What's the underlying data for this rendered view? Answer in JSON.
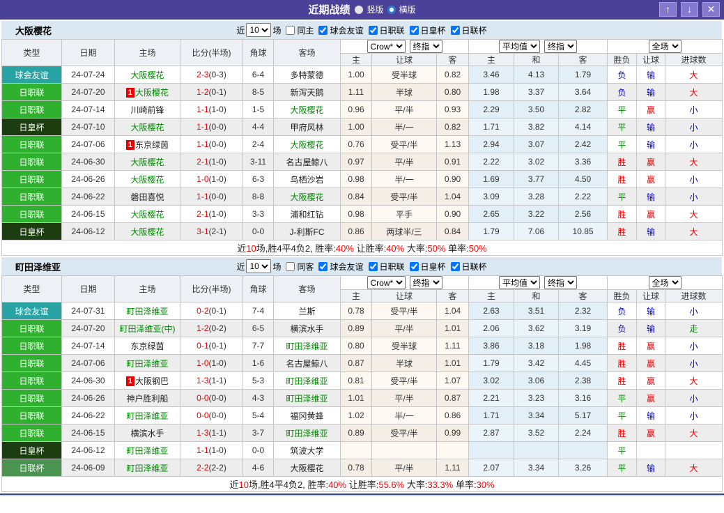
{
  "titlebar": {
    "title": "近期战绩",
    "vertical_label": "竖版",
    "horizontal_label": "横版",
    "buttons": {
      "up_icon": "↑",
      "down_icon": "↓",
      "close_icon": "✕"
    }
  },
  "colors": {
    "topbar": "#4C4199",
    "section_band": "#DBE7F1",
    "type_friendly": "#29A3A3",
    "type_jleague": "#2FB12F",
    "type_emperor": "#1B3D10",
    "type_lcup": "#4A9350",
    "team_green": "#008800",
    "win_red": "#E60000",
    "lose_blue": "#0000D6",
    "draw_green": "#008800"
  },
  "table_headers": {
    "left_columns": [
      "类型",
      "日期",
      "主场",
      "比分(半场)",
      "角球",
      "客场"
    ],
    "crow_group": {
      "select1": "Crow*",
      "select2": "终指",
      "cols": [
        "主",
        "让球",
        "客"
      ]
    },
    "avg_group": {
      "select1": "平均值",
      "select2": "终指",
      "cols": [
        "主",
        "和",
        "客"
      ]
    },
    "full_group": {
      "select": "全场",
      "cols": [
        "胜负",
        "让球",
        "进球数"
      ]
    }
  },
  "tables": [
    {
      "team": "大阪樱花",
      "filter": {
        "prefix": "近",
        "count": "10",
        "suffix": "场",
        "same_label": "同主",
        "leagues": [
          "球会友谊",
          "日职联",
          "日皇杯",
          "日联杯"
        ]
      },
      "rows": [
        {
          "type": "球会友谊",
          "tc": "friendly",
          "date": "24-07-24",
          "home": "大阪樱花",
          "hG": 1,
          "hB": 0,
          "score": "2-3",
          "half": "(0-3)",
          "corner": "6-4",
          "away": "多特蒙德",
          "aG": 0,
          "o": [
            "1.00",
            "受半球",
            "0.82"
          ],
          "avg": [
            "3.46",
            "4.13",
            "1.79"
          ],
          "res": [
            "负",
            "b"
          ],
          "hr": [
            "输",
            "b"
          ],
          "goal": [
            "大",
            "r"
          ]
        },
        {
          "type": "日职联",
          "tc": "jleague",
          "date": "24-07-20",
          "home": "大阪樱花",
          "hG": 1,
          "hB": 1,
          "score": "1-2",
          "half": "(0-1)",
          "corner": "8-5",
          "away": "新泻天鹅",
          "aG": 0,
          "o": [
            "1.11",
            "半球",
            "0.80"
          ],
          "avg": [
            "1.98",
            "3.37",
            "3.64"
          ],
          "res": [
            "负",
            "b"
          ],
          "hr": [
            "输",
            "b"
          ],
          "goal": [
            "大",
            "r"
          ]
        },
        {
          "type": "日职联",
          "tc": "jleague",
          "date": "24-07-14",
          "home": "川崎前锋",
          "hG": 0,
          "hB": 0,
          "score": "1-1",
          "half": "(1-0)",
          "corner": "1-5",
          "away": "大阪樱花",
          "aG": 1,
          "o": [
            "0.96",
            "平/半",
            "0.93"
          ],
          "avg": [
            "2.29",
            "3.50",
            "2.82"
          ],
          "res": [
            "平",
            "g"
          ],
          "hr": [
            "赢",
            "r"
          ],
          "goal": [
            "小",
            "b"
          ]
        },
        {
          "type": "日皇杯",
          "tc": "emperor",
          "date": "24-07-10",
          "home": "大阪樱花",
          "hG": 1,
          "hB": 0,
          "score": "1-1",
          "half": "(0-0)",
          "corner": "4-4",
          "away": "甲府风林",
          "aG": 0,
          "o": [
            "1.00",
            "半/一",
            "0.82"
          ],
          "avg": [
            "1.71",
            "3.82",
            "4.14"
          ],
          "res": [
            "平",
            "g"
          ],
          "hr": [
            "输",
            "b"
          ],
          "goal": [
            "小",
            "b"
          ]
        },
        {
          "type": "日职联",
          "tc": "jleague",
          "date": "24-07-06",
          "home": "东京绿茵",
          "hG": 0,
          "hB": 1,
          "score": "1-1",
          "half": "(0-0)",
          "corner": "2-4",
          "away": "大阪樱花",
          "aG": 1,
          "o": [
            "0.76",
            "受平/半",
            "1.13"
          ],
          "avg": [
            "2.94",
            "3.07",
            "2.42"
          ],
          "res": [
            "平",
            "g"
          ],
          "hr": [
            "输",
            "b"
          ],
          "goal": [
            "小",
            "b"
          ]
        },
        {
          "type": "日职联",
          "tc": "jleague",
          "date": "24-06-30",
          "home": "大阪樱花",
          "hG": 1,
          "hB": 0,
          "score": "2-1",
          "half": "(1-0)",
          "corner": "3-11",
          "away": "名古屋鲸八",
          "aG": 0,
          "o": [
            "0.97",
            "平/半",
            "0.91"
          ],
          "avg": [
            "2.22",
            "3.02",
            "3.36"
          ],
          "res": [
            "胜",
            "r"
          ],
          "hr": [
            "赢",
            "r"
          ],
          "goal": [
            "大",
            "r"
          ]
        },
        {
          "type": "日职联",
          "tc": "jleague",
          "date": "24-06-26",
          "home": "大阪樱花",
          "hG": 1,
          "hB": 0,
          "score": "1-0",
          "half": "(1-0)",
          "corner": "6-3",
          "away": "鸟栖沙岩",
          "aG": 0,
          "o": [
            "0.98",
            "半/一",
            "0.90"
          ],
          "avg": [
            "1.69",
            "3.77",
            "4.50"
          ],
          "res": [
            "胜",
            "r"
          ],
          "hr": [
            "赢",
            "r"
          ],
          "goal": [
            "小",
            "b"
          ]
        },
        {
          "type": "日职联",
          "tc": "jleague",
          "date": "24-06-22",
          "home": "磐田喜悦",
          "hG": 0,
          "hB": 0,
          "score": "1-1",
          "half": "(0-0)",
          "corner": "8-8",
          "away": "大阪樱花",
          "aG": 1,
          "o": [
            "0.84",
            "受平/半",
            "1.04"
          ],
          "avg": [
            "3.09",
            "3.28",
            "2.22"
          ],
          "res": [
            "平",
            "g"
          ],
          "hr": [
            "输",
            "b"
          ],
          "goal": [
            "小",
            "b"
          ]
        },
        {
          "type": "日职联",
          "tc": "jleague",
          "date": "24-06-15",
          "home": "大阪樱花",
          "hG": 1,
          "hB": 0,
          "score": "2-1",
          "half": "(1-0)",
          "corner": "3-3",
          "away": "浦和红钻",
          "aG": 0,
          "o": [
            "0.98",
            "平手",
            "0.90"
          ],
          "avg": [
            "2.65",
            "3.22",
            "2.56"
          ],
          "res": [
            "胜",
            "r"
          ],
          "hr": [
            "赢",
            "r"
          ],
          "goal": [
            "大",
            "r"
          ]
        },
        {
          "type": "日皇杯",
          "tc": "emperor",
          "date": "24-06-12",
          "home": "大阪樱花",
          "hG": 1,
          "hB": 0,
          "score": "3-1",
          "half": "(2-1)",
          "corner": "0-0",
          "away": "J-利斯FC",
          "aG": 0,
          "o": [
            "0.86",
            "两球半/三",
            "0.84"
          ],
          "avg": [
            "1.79",
            "7.06",
            "10.85"
          ],
          "res": [
            "胜",
            "r"
          ],
          "hr": [
            "输",
            "b"
          ],
          "goal": [
            "大",
            "r"
          ]
        }
      ],
      "summary": [
        {
          "t": "近",
          "r": 0
        },
        {
          "t": "10",
          "r": 1
        },
        {
          "t": "场,胜4平4负2, 胜率:",
          "r": 0
        },
        {
          "t": "40%",
          "r": 1
        },
        {
          "t": " 让胜率:",
          "r": 0
        },
        {
          "t": "40%",
          "r": 1
        },
        {
          "t": " 大率:",
          "r": 0
        },
        {
          "t": "50%",
          "r": 1
        },
        {
          "t": " 单率:",
          "r": 0
        },
        {
          "t": "50%",
          "r": 1
        }
      ]
    },
    {
      "team": "町田泽维亚",
      "filter": {
        "prefix": "近",
        "count": "10",
        "suffix": "场",
        "same_label": "同客",
        "leagues": [
          "球会友谊",
          "日职联",
          "日皇杯",
          "日联杯"
        ]
      },
      "rows": [
        {
          "type": "球会友谊",
          "tc": "friendly",
          "date": "24-07-31",
          "home": "町田泽维亚",
          "hG": 1,
          "hB": 0,
          "score": "0-2",
          "half": "(0-1)",
          "corner": "7-4",
          "away": "兰斯",
          "aG": 0,
          "o": [
            "0.78",
            "受平/半",
            "1.04"
          ],
          "avg": [
            "2.63",
            "3.51",
            "2.32"
          ],
          "res": [
            "负",
            "b"
          ],
          "hr": [
            "输",
            "b"
          ],
          "goal": [
            "小",
            "b"
          ]
        },
        {
          "type": "日职联",
          "tc": "jleague",
          "date": "24-07-20",
          "home": "町田泽维亚(中)",
          "hG": 1,
          "hB": 0,
          "score": "1-2",
          "half": "(0-2)",
          "corner": "6-5",
          "away": "横滨水手",
          "aG": 0,
          "o": [
            "0.89",
            "平/半",
            "1.01"
          ],
          "avg": [
            "2.06",
            "3.62",
            "3.19"
          ],
          "res": [
            "负",
            "b"
          ],
          "hr": [
            "输",
            "b"
          ],
          "goal": [
            "走",
            "g"
          ]
        },
        {
          "type": "日职联",
          "tc": "jleague",
          "date": "24-07-14",
          "home": "东京绿茵",
          "hG": 0,
          "hB": 0,
          "score": "0-1",
          "half": "(0-1)",
          "corner": "7-7",
          "away": "町田泽维亚",
          "aG": 1,
          "o": [
            "0.80",
            "受半球",
            "1.11"
          ],
          "avg": [
            "3.86",
            "3.18",
            "1.98"
          ],
          "res": [
            "胜",
            "r"
          ],
          "hr": [
            "赢",
            "r"
          ],
          "goal": [
            "小",
            "b"
          ]
        },
        {
          "type": "日职联",
          "tc": "jleague",
          "date": "24-07-06",
          "home": "町田泽维亚",
          "hG": 1,
          "hB": 0,
          "score": "1-0",
          "half": "(1-0)",
          "corner": "1-6",
          "away": "名古屋鲸八",
          "aG": 0,
          "o": [
            "0.87",
            "半球",
            "1.01"
          ],
          "avg": [
            "1.79",
            "3.42",
            "4.45"
          ],
          "res": [
            "胜",
            "r"
          ],
          "hr": [
            "赢",
            "r"
          ],
          "goal": [
            "小",
            "b"
          ]
        },
        {
          "type": "日职联",
          "tc": "jleague",
          "date": "24-06-30",
          "home": "大阪钢巴",
          "hG": 0,
          "hB": 1,
          "score": "1-3",
          "half": "(1-1)",
          "corner": "5-3",
          "away": "町田泽维亚",
          "aG": 1,
          "o": [
            "0.81",
            "受平/半",
            "1.07"
          ],
          "avg": [
            "3.02",
            "3.06",
            "2.38"
          ],
          "res": [
            "胜",
            "r"
          ],
          "hr": [
            "赢",
            "r"
          ],
          "goal": [
            "大",
            "r"
          ]
        },
        {
          "type": "日职联",
          "tc": "jleague",
          "date": "24-06-26",
          "home": "神户胜利船",
          "hG": 0,
          "hB": 0,
          "score": "0-0",
          "half": "(0-0)",
          "corner": "4-3",
          "away": "町田泽维亚",
          "aG": 1,
          "o": [
            "1.01",
            "平/半",
            "0.87"
          ],
          "avg": [
            "2.21",
            "3.23",
            "3.16"
          ],
          "res": [
            "平",
            "g"
          ],
          "hr": [
            "赢",
            "r"
          ],
          "goal": [
            "小",
            "b"
          ]
        },
        {
          "type": "日职联",
          "tc": "jleague",
          "date": "24-06-22",
          "home": "町田泽维亚",
          "hG": 1,
          "hB": 0,
          "score": "0-0",
          "half": "(0-0)",
          "corner": "5-4",
          "away": "福冈黄蜂",
          "aG": 0,
          "o": [
            "1.02",
            "半/一",
            "0.86"
          ],
          "avg": [
            "1.71",
            "3.34",
            "5.17"
          ],
          "res": [
            "平",
            "g"
          ],
          "hr": [
            "输",
            "b"
          ],
          "goal": [
            "小",
            "b"
          ]
        },
        {
          "type": "日职联",
          "tc": "jleague",
          "date": "24-06-15",
          "home": "横滨水手",
          "hG": 0,
          "hB": 0,
          "score": "1-3",
          "half": "(1-1)",
          "corner": "3-7",
          "away": "町田泽维亚",
          "aG": 1,
          "o": [
            "0.89",
            "受平/半",
            "0.99"
          ],
          "avg": [
            "2.87",
            "3.52",
            "2.24"
          ],
          "res": [
            "胜",
            "r"
          ],
          "hr": [
            "赢",
            "r"
          ],
          "goal": [
            "大",
            "r"
          ]
        },
        {
          "type": "日皇杯",
          "tc": "emperor",
          "date": "24-06-12",
          "home": "町田泽维亚",
          "hG": 1,
          "hB": 0,
          "score": "1-1",
          "half": "(1-0)",
          "corner": "0-0",
          "away": "筑波大学",
          "aG": 0,
          "o": [
            "",
            "",
            ""
          ],
          "avg": [
            "",
            "",
            ""
          ],
          "res": [
            "平",
            "g"
          ],
          "hr": [
            "",
            ""
          ],
          "goal": [
            "",
            ""
          ]
        },
        {
          "type": "日联杯",
          "tc": "lcup",
          "date": "24-06-09",
          "home": "町田泽维亚",
          "hG": 1,
          "hB": 0,
          "score": "2-2",
          "half": "(2-2)",
          "corner": "4-6",
          "away": "大阪樱花",
          "aG": 0,
          "o": [
            "0.78",
            "平/半",
            "1.11"
          ],
          "avg": [
            "2.07",
            "3.34",
            "3.26"
          ],
          "res": [
            "平",
            "g"
          ],
          "hr": [
            "输",
            "b"
          ],
          "goal": [
            "大",
            "r"
          ]
        }
      ],
      "summary": [
        {
          "t": "近",
          "r": 0
        },
        {
          "t": "10",
          "r": 1
        },
        {
          "t": "场,胜4平4负2, 胜率:",
          "r": 0
        },
        {
          "t": "40%",
          "r": 1
        },
        {
          "t": " 让胜率:",
          "r": 0
        },
        {
          "t": "55.6%",
          "r": 1
        },
        {
          "t": " 大率:",
          "r": 0
        },
        {
          "t": "33.3%",
          "r": 1
        },
        {
          "t": " 单率:",
          "r": 0
        },
        {
          "t": "30%",
          "r": 1
        }
      ]
    }
  ]
}
